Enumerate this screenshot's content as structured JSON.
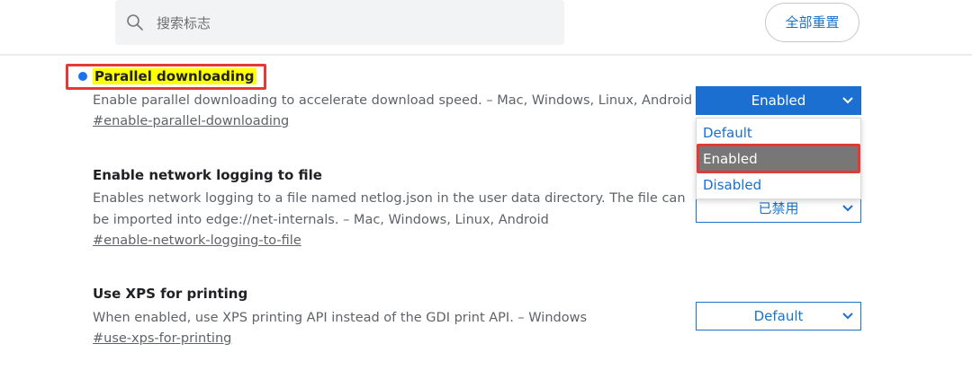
{
  "search": {
    "placeholder": "搜索标志"
  },
  "header": {
    "reset_label": "全部重置"
  },
  "flags": [
    {
      "title": "Parallel downloading",
      "description": "Enable parallel downloading to accelerate download speed. – Mac, Windows, Linux, Android",
      "link": "#enable-parallel-downloading",
      "select_value": "Enabled",
      "dropdown_options": [
        "Default",
        "Enabled",
        "Disabled"
      ],
      "highlighted_option": "Enabled"
    },
    {
      "title": "Enable network logging to file",
      "description_line1": "Enables network logging to a file named netlog.json in the user data directory. The file can",
      "description_line2": "be imported into edge://net-internals. – Mac, Windows, Linux, Android",
      "link": "#enable-network-logging-to-file",
      "select_value": "已禁用"
    },
    {
      "title": "Use XPS for printing",
      "description": "When enabled, use XPS printing API instead of the GDI print API. – Windows",
      "link": "#use-xps-for-printing",
      "select_value": "Default"
    }
  ],
  "colors": {
    "accent": "#1a6fd1",
    "highlight": "#ffff00",
    "annotation_red": "#e53935",
    "selected_option_bg": "#777777"
  },
  "icons": [
    "search-icon",
    "chevron-down-icon"
  ]
}
